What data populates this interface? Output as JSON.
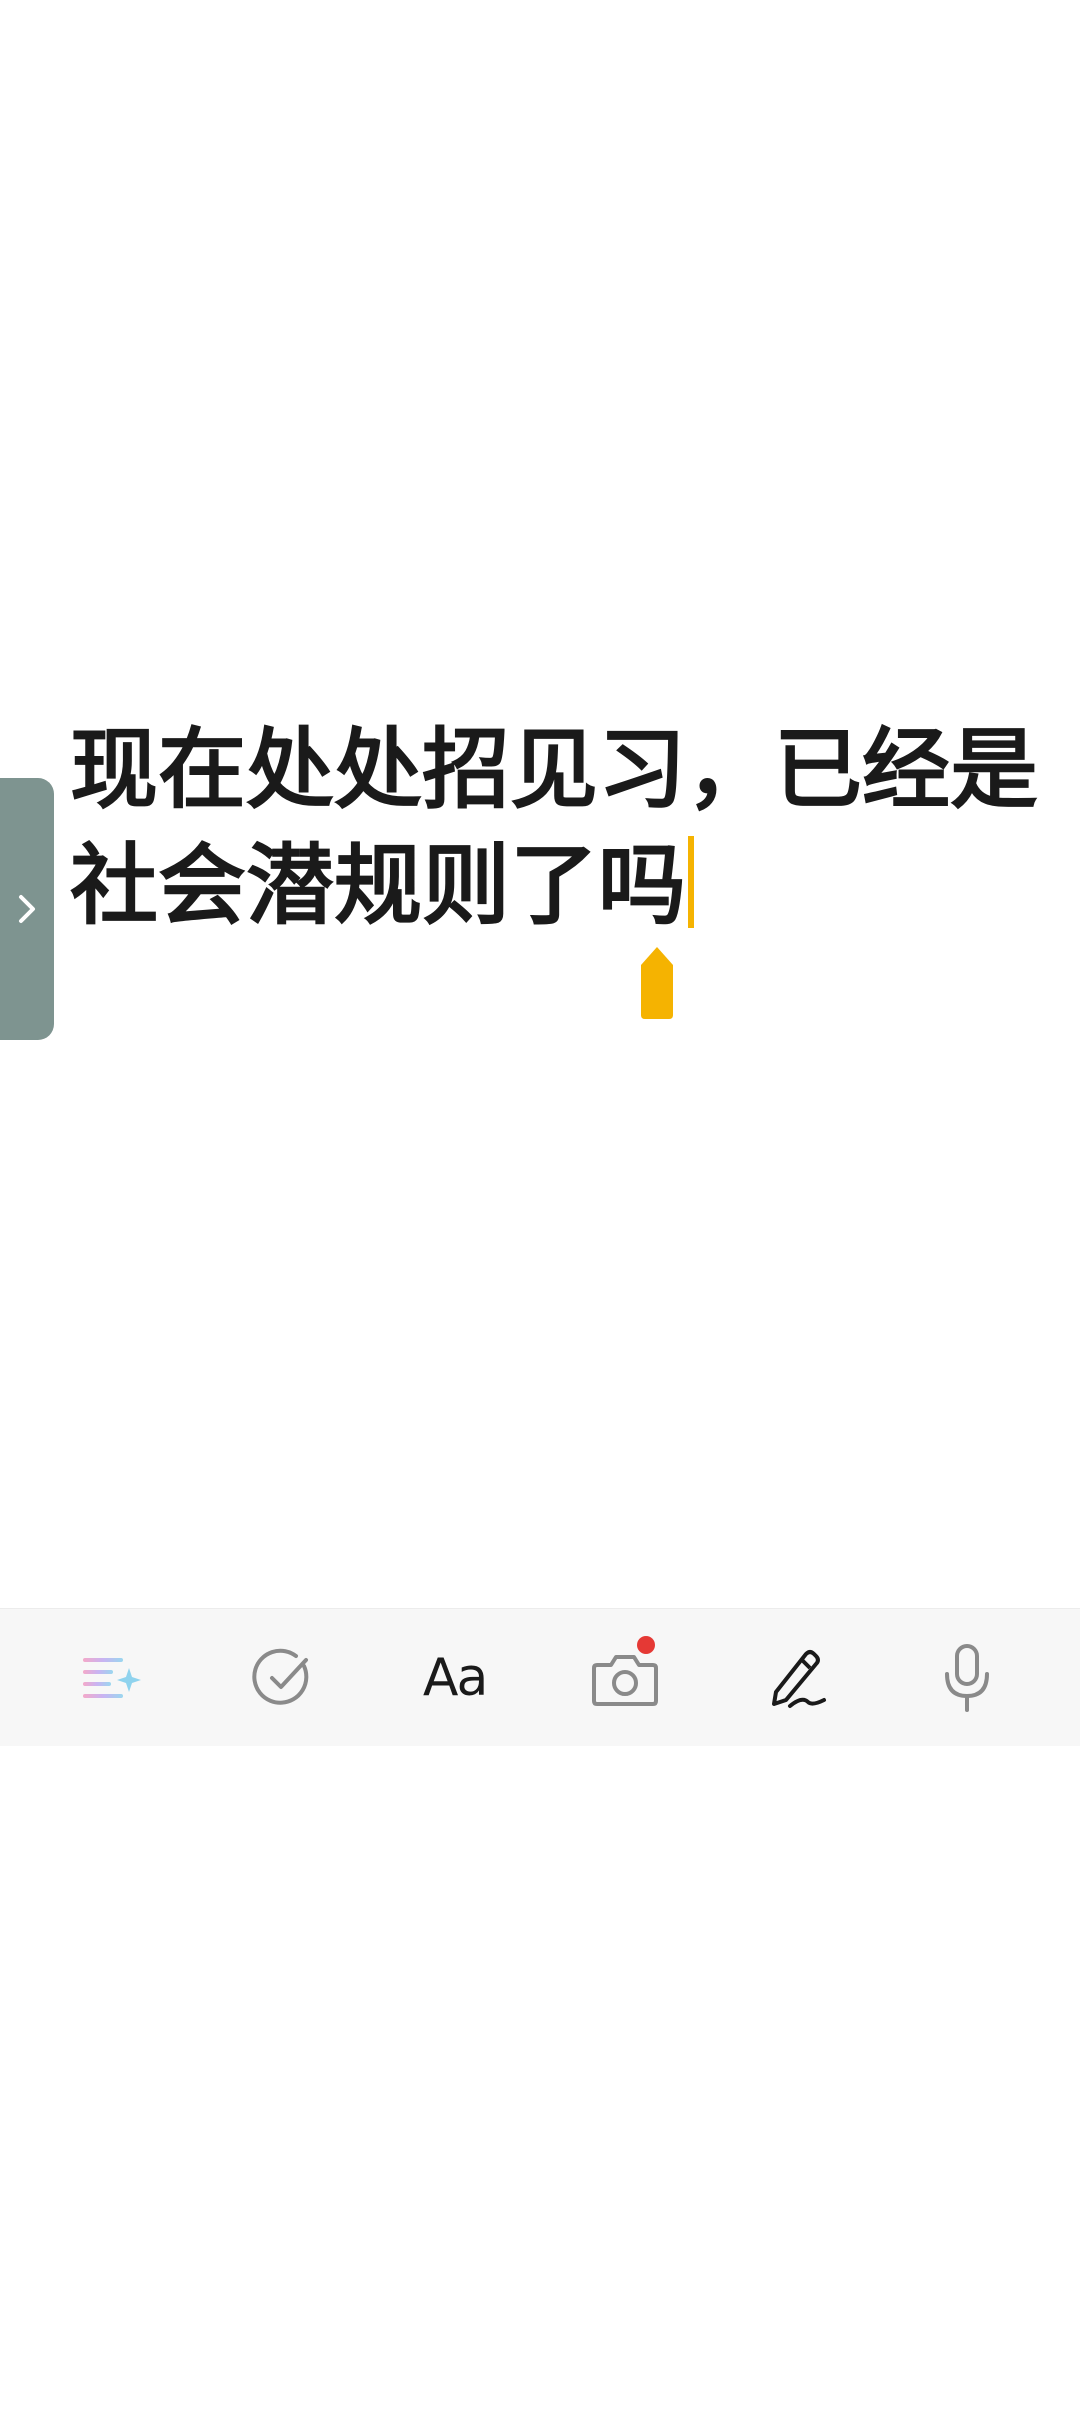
{
  "note": {
    "lines": [
      "现在处处招见习，已经是",
      "社会潜规则了吗"
    ]
  },
  "side_tab": {
    "icon": "chevron-right-icon"
  },
  "toolbar": {
    "items": [
      {
        "name": "ai-format",
        "icon": "sparkle-list-icon"
      },
      {
        "name": "checklist",
        "icon": "check-circle-icon"
      },
      {
        "name": "text-style",
        "icon": "text-style-icon",
        "label": "Aa"
      },
      {
        "name": "camera",
        "icon": "camera-icon"
      },
      {
        "name": "handwriting",
        "icon": "pen-icon"
      },
      {
        "name": "voice",
        "icon": "microphone-icon"
      }
    ]
  },
  "colors": {
    "caret": "#f5b301",
    "side_tab": "#7e9490",
    "badge": "#e53935",
    "toolbar_bg": "#f7f7f7"
  }
}
